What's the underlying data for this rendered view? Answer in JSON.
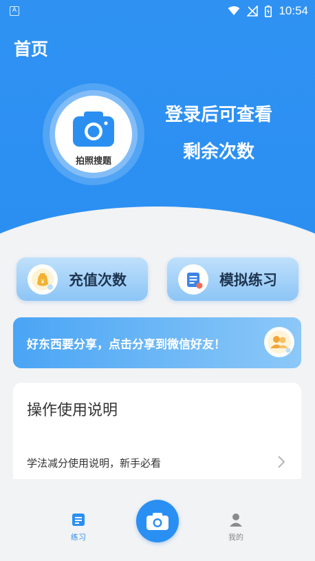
{
  "status": {
    "time": "10:54",
    "notification_icon": "A"
  },
  "header": {
    "title": "首页"
  },
  "hero": {
    "camera_label": "拍照搜题",
    "message_line1": "登录后可查看",
    "message_line2": "剩余次数"
  },
  "actions": [
    {
      "label": "充值次数",
      "icon": "money-bag-icon"
    },
    {
      "label": "模拟练习",
      "icon": "document-icon"
    }
  ],
  "share": {
    "text": "好东西要分享，点击分享到微信好友！"
  },
  "guide": {
    "title": "操作使用说明",
    "items": [
      {
        "text": "学法减分使用说明，新手必看"
      }
    ]
  },
  "tabbar": {
    "tabs": [
      {
        "label": "练习",
        "icon": "list-icon",
        "active": true
      },
      {
        "label": "我的",
        "icon": "person-icon",
        "active": false
      }
    ],
    "center_icon": "camera-icon"
  },
  "colors": {
    "primary": "#2b8ff2",
    "button_gradient_top": "#bfe0fb",
    "button_gradient_bottom": "#8cc5f6",
    "tab_active": "#2b8ff2",
    "tab_inactive": "#888888"
  }
}
